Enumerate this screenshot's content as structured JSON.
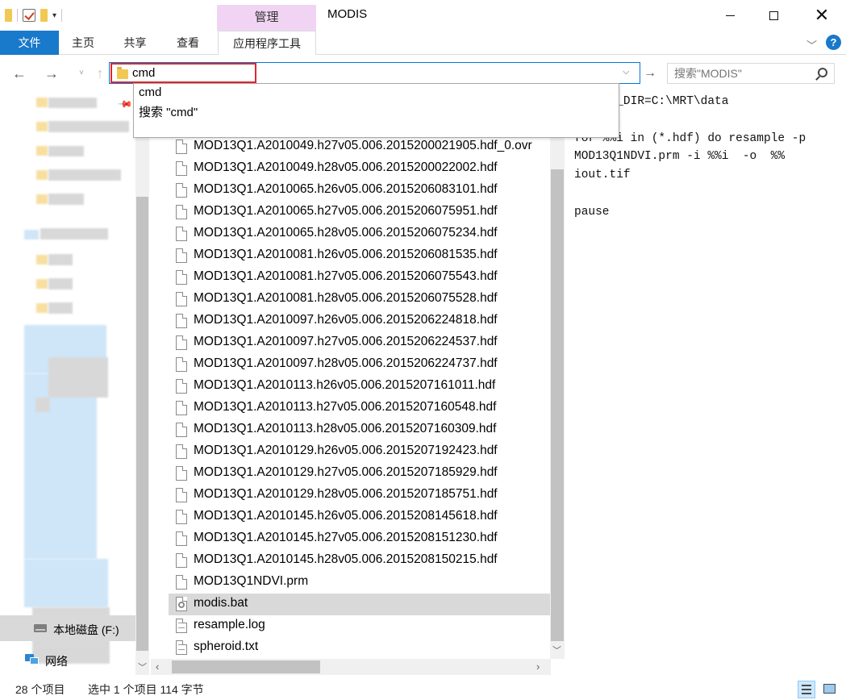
{
  "window": {
    "title": "MODIS",
    "contextual_tab_group": "管理"
  },
  "ribbon": {
    "tabs": [
      "文件",
      "主页",
      "共享",
      "查看",
      "应用程序工具"
    ]
  },
  "address": {
    "value": "cmd",
    "suggestions": [
      "cmd",
      "搜索 \"cmd\""
    ]
  },
  "search": {
    "placeholder": "搜索\"MODIS\""
  },
  "nav_pane": {
    "drive_label": "本地磁盘 (F:)",
    "network_label": "网络"
  },
  "files": [
    {
      "name": "MOD13Q1.A2010049.h27v05.006.2015200021905.hdf_0.ovr",
      "icon": "file-icon"
    },
    {
      "name": "MOD13Q1.A2010049.h28v05.006.2015200022002.hdf",
      "icon": "file-icon"
    },
    {
      "name": "MOD13Q1.A2010065.h26v05.006.2015206083101.hdf",
      "icon": "file-icon"
    },
    {
      "name": "MOD13Q1.A2010065.h27v05.006.2015206075951.hdf",
      "icon": "file-icon"
    },
    {
      "name": "MOD13Q1.A2010065.h28v05.006.2015206075234.hdf",
      "icon": "file-icon"
    },
    {
      "name": "MOD13Q1.A2010081.h26v05.006.2015206081535.hdf",
      "icon": "file-icon"
    },
    {
      "name": "MOD13Q1.A2010081.h27v05.006.2015206075543.hdf",
      "icon": "file-icon"
    },
    {
      "name": "MOD13Q1.A2010081.h28v05.006.2015206075528.hdf",
      "icon": "file-icon"
    },
    {
      "name": "MOD13Q1.A2010097.h26v05.006.2015206224818.hdf",
      "icon": "file-icon"
    },
    {
      "name": "MOD13Q1.A2010097.h27v05.006.2015206224537.hdf",
      "icon": "file-icon"
    },
    {
      "name": "MOD13Q1.A2010097.h28v05.006.2015206224737.hdf",
      "icon": "file-icon"
    },
    {
      "name": "MOD13Q1.A2010113.h26v05.006.2015207161011.hdf",
      "icon": "file-icon"
    },
    {
      "name": "MOD13Q1.A2010113.h27v05.006.2015207160548.hdf",
      "icon": "file-icon"
    },
    {
      "name": "MOD13Q1.A2010113.h28v05.006.2015207160309.hdf",
      "icon": "file-icon"
    },
    {
      "name": "MOD13Q1.A2010129.h26v05.006.2015207192423.hdf",
      "icon": "file-icon"
    },
    {
      "name": "MOD13Q1.A2010129.h27v05.006.2015207185929.hdf",
      "icon": "file-icon"
    },
    {
      "name": "MOD13Q1.A2010129.h28v05.006.2015207185751.hdf",
      "icon": "file-icon"
    },
    {
      "name": "MOD13Q1.A2010145.h26v05.006.2015208145618.hdf",
      "icon": "file-icon"
    },
    {
      "name": "MOD13Q1.A2010145.h27v05.006.2015208151230.hdf",
      "icon": "file-icon"
    },
    {
      "name": "MOD13Q1.A2010145.h28v05.006.2015208150215.hdf",
      "icon": "file-icon"
    },
    {
      "name": "MOD13Q1NDVI.prm",
      "icon": "file-icon"
    },
    {
      "name": "modis.bat",
      "icon": "batch-file-icon",
      "selected": true
    },
    {
      "name": "resample.log",
      "icon": "text-file-icon"
    },
    {
      "name": "spheroid.txt",
      "icon": "text-file-icon"
    }
  ],
  "preview": {
    "lines": [
      "T_DATA_DIR=C:\\MRT\\data",
      "",
      "for %%i in (*.hdf) do resample -p",
      "MOD13Q1NDVI.prm -i %%i  -o  %%",
      "iout.tif",
      "",
      "pause"
    ]
  },
  "status": {
    "item_count": "28 个项目",
    "selection": "选中 1 个项目  114 字节"
  },
  "colors": {
    "accent": "#1979ca",
    "contextual_tab": "#f1d4f4",
    "highlight_box": "#e0262c",
    "selected_row": "#d9d9d9"
  }
}
